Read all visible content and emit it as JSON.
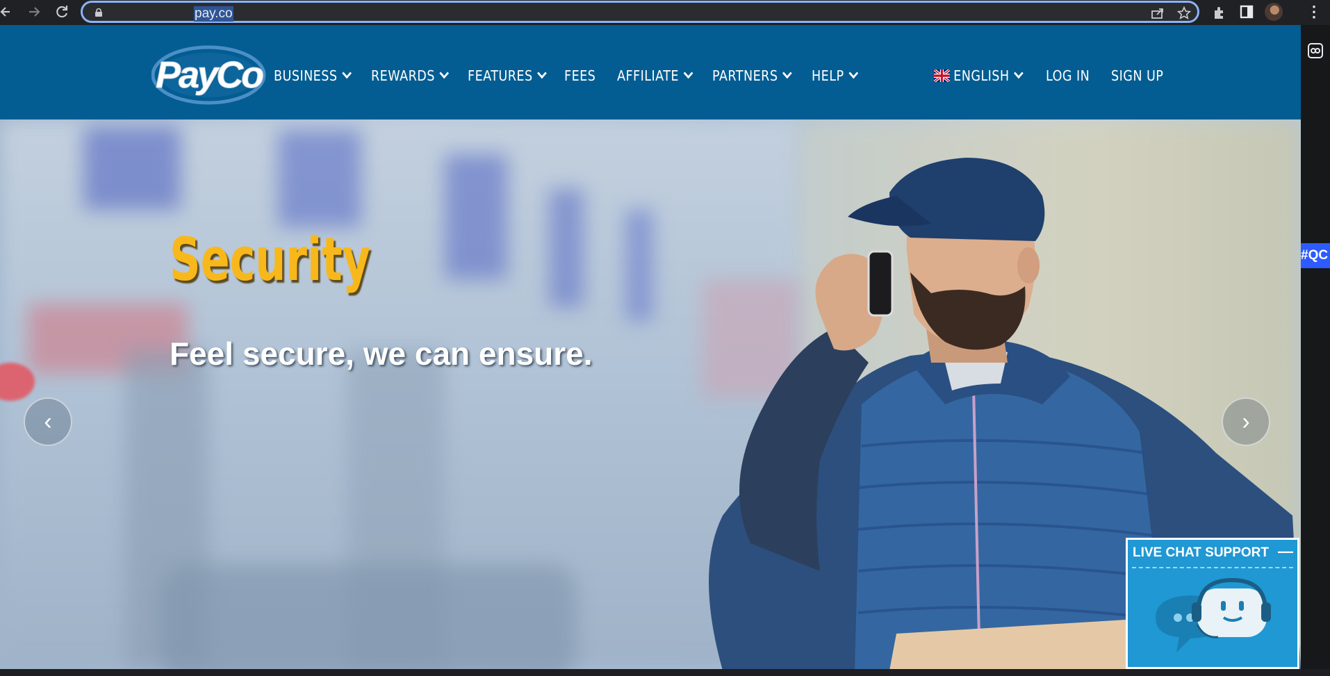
{
  "browser": {
    "url": "pay.co",
    "back_icon": "arrow-left-icon",
    "forward_icon": "arrow-right-icon",
    "reload_icon": "reload-icon",
    "menu_icon": "⋮"
  },
  "site": {
    "logo_text": "PayCo",
    "brand_color": "#035d92",
    "accent_color": "#f8b81b",
    "nav": {
      "items": [
        {
          "label": "BUSINESS",
          "dropdown": true
        },
        {
          "label": "REWARDS",
          "dropdown": true
        },
        {
          "label": "FEATURES",
          "dropdown": true
        },
        {
          "label": "FEES",
          "dropdown": false
        },
        {
          "label": "AFFILIATE",
          "dropdown": true
        },
        {
          "label": "PARTNERS",
          "dropdown": true
        },
        {
          "label": "HELP",
          "dropdown": true
        }
      ],
      "language": "ENGLISH",
      "login": "LOG IN",
      "signup": "SIGN UP"
    },
    "hero": {
      "headline": "Security",
      "subline": "Feel secure, we can ensure.",
      "prev": "‹",
      "next": "›"
    },
    "chat": {
      "title": "LIVE CHAT SUPPORT",
      "minimize": "—"
    },
    "side_badge": "#QC"
  }
}
